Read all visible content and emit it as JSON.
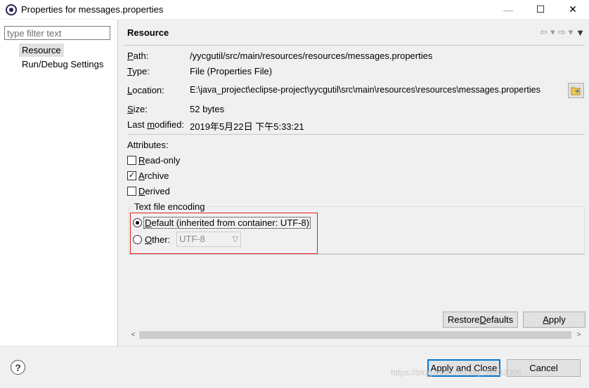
{
  "window": {
    "title": "Properties for messages.properties",
    "minimize_glyph": "—",
    "maximize_glyph": "☐",
    "close_glyph": "✕"
  },
  "left": {
    "filter_placeholder": "type filter text",
    "items": [
      "Resource",
      "Run/Debug Settings"
    ]
  },
  "page": {
    "title": "Resource",
    "nav_back": "⇦",
    "nav_forward": "⇨",
    "dropdown": "▾",
    "view_menu": "▼"
  },
  "props": {
    "path_label_u": "P",
    "path_label_rest": "ath:",
    "path_value": "/yycgutil/src/main/resources/resources/messages.properties",
    "type_label_u": "T",
    "type_label_rest": "ype:",
    "type_value": "File  (Properties File)",
    "location_label_u": "L",
    "location_label_rest": "ocation:",
    "location_value": "E:\\java_project\\eclipse-project\\yycgutil\\src\\main\\resources\\resources\\messages.properties",
    "size_label_u": "S",
    "size_label_rest": "ize:",
    "size_value": "52  bytes",
    "modified_label_pre": "Last ",
    "modified_label_u": "m",
    "modified_label_rest": "odified:",
    "modified_value": "2019年5月22日 下午5:33:21"
  },
  "attributes": {
    "heading": "Attributes:",
    "readonly_u": "R",
    "readonly_rest": "ead-only",
    "archive_u": "A",
    "archive_rest": "rchive",
    "derived_u": "D",
    "derived_rest": "erived",
    "checked_glyph": "✓"
  },
  "encoding": {
    "group_label": "Text file encoding",
    "default_u": "D",
    "default_rest": "efault (inherited from container: UTF-8)",
    "other_u": "O",
    "other_rest": "ther:",
    "other_value": "UTF-8",
    "select_arrow": "▽"
  },
  "buttons": {
    "restore_defaults_pre": "Restore ",
    "restore_defaults_u": "D",
    "restore_defaults_rest": "efaults",
    "apply_u": "A",
    "apply_rest": "pply",
    "apply_close": "Apply and Close",
    "cancel": "Cancel"
  },
  "scroll": {
    "left_arrow": "<",
    "right_arrow": ">"
  },
  "help": "?",
  "watermark": "https://blog.csdn.net/xiq_38232096"
}
